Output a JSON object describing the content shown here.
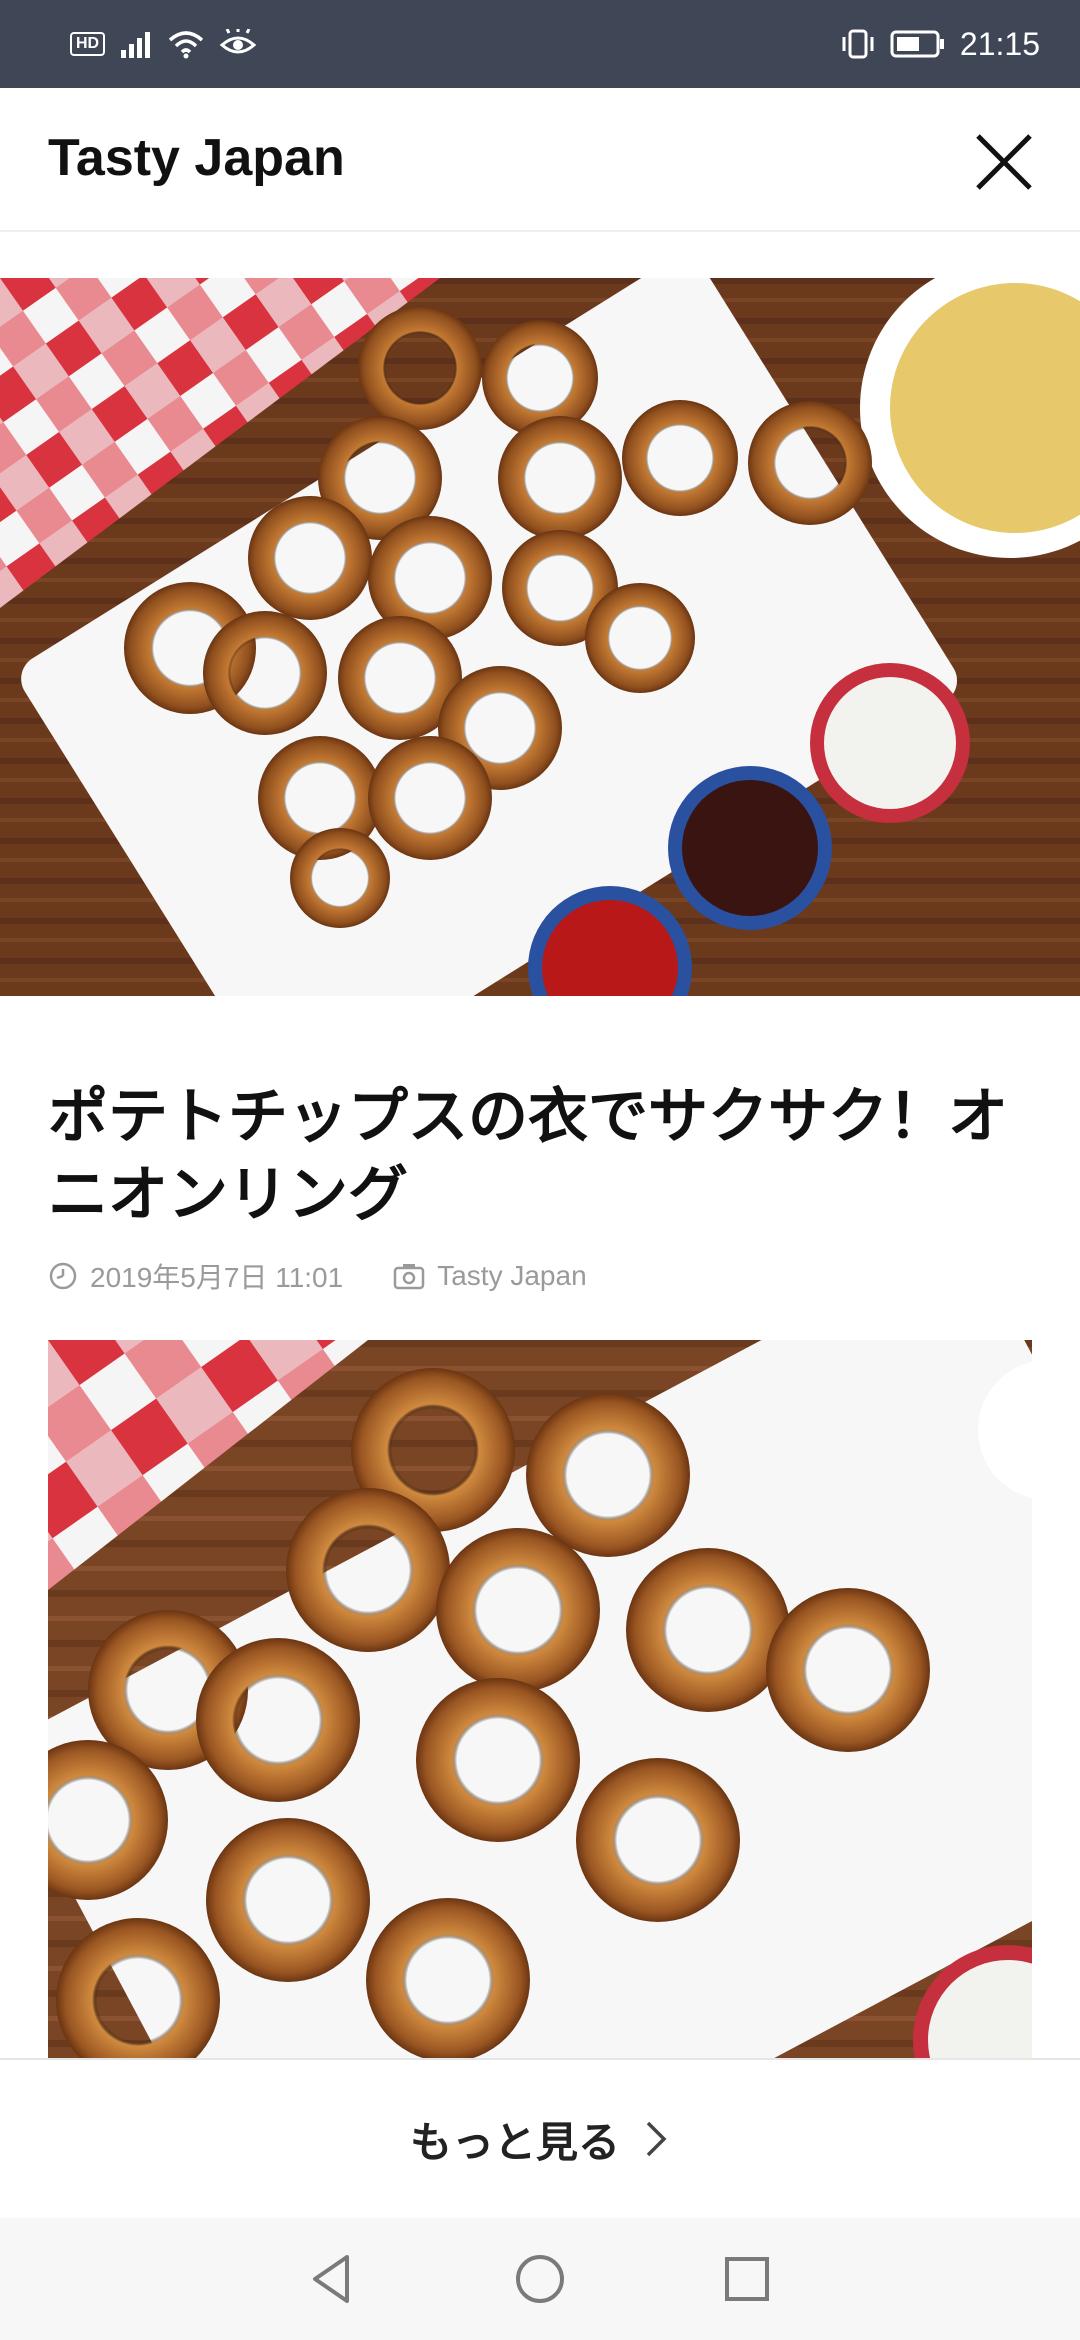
{
  "status_bar": {
    "network_badge": "HD",
    "time": "21:15",
    "icons": [
      "hd-icon",
      "signal-icon",
      "wifi-icon",
      "eye-icon",
      "vibrate-icon",
      "battery-icon"
    ]
  },
  "header": {
    "title": "Tasty Japan",
    "close_icon": "close-icon"
  },
  "article": {
    "title": "ポテトチップスの衣でサクサク！オニオンリング",
    "date": "2019年5月7日 11:01",
    "source": "Tasty Japan"
  },
  "footer": {
    "more_label": "もっと見る"
  },
  "nav": {
    "icons": [
      "back-icon",
      "home-icon",
      "recents-icon"
    ]
  },
  "colors": {
    "status_bar": "#3f4656",
    "wood": "#6b3a1d",
    "checker_red": "#d8333f",
    "onion_ring": "#b9702c"
  }
}
